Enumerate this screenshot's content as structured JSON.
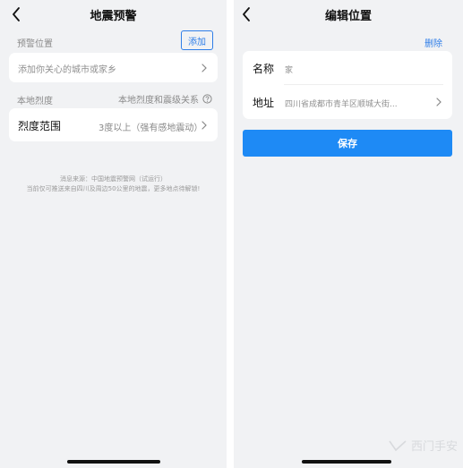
{
  "left_screen": {
    "title": "地震预警",
    "warning_location_label": "预警位置",
    "add_button": "添加",
    "add_city_placeholder": "添加你关心的城市或家乡",
    "local_intensity_label": "本地烈度",
    "intensity_relation_link": "本地烈度和震级关系",
    "intensity_range_label": "烈度范围",
    "intensity_range_value": "3度以上（强有感地震动）",
    "source_note_line1": "消息来源：中国地震预警网（试运行）",
    "source_note_line2": "当前仅可推送来自四川及周边50公里的地震，更多地点待解锁!"
  },
  "right_screen": {
    "title": "编辑位置",
    "delete_button": "删除",
    "name_label": "名称",
    "name_value": "家",
    "address_label": "地址",
    "address_value": "四川省成都市青羊区顺城大街...",
    "save_button": "保存"
  },
  "watermark": {
    "text": "西门手安"
  },
  "colors": {
    "accent_blue": "#2f7ee8",
    "save_blue": "#1e8af5",
    "page_bg": "#f1f2f4"
  },
  "icons": {
    "back": "chevron-left-icon",
    "row_chevron": "chevron-right-icon",
    "help": "question-circle-icon"
  }
}
